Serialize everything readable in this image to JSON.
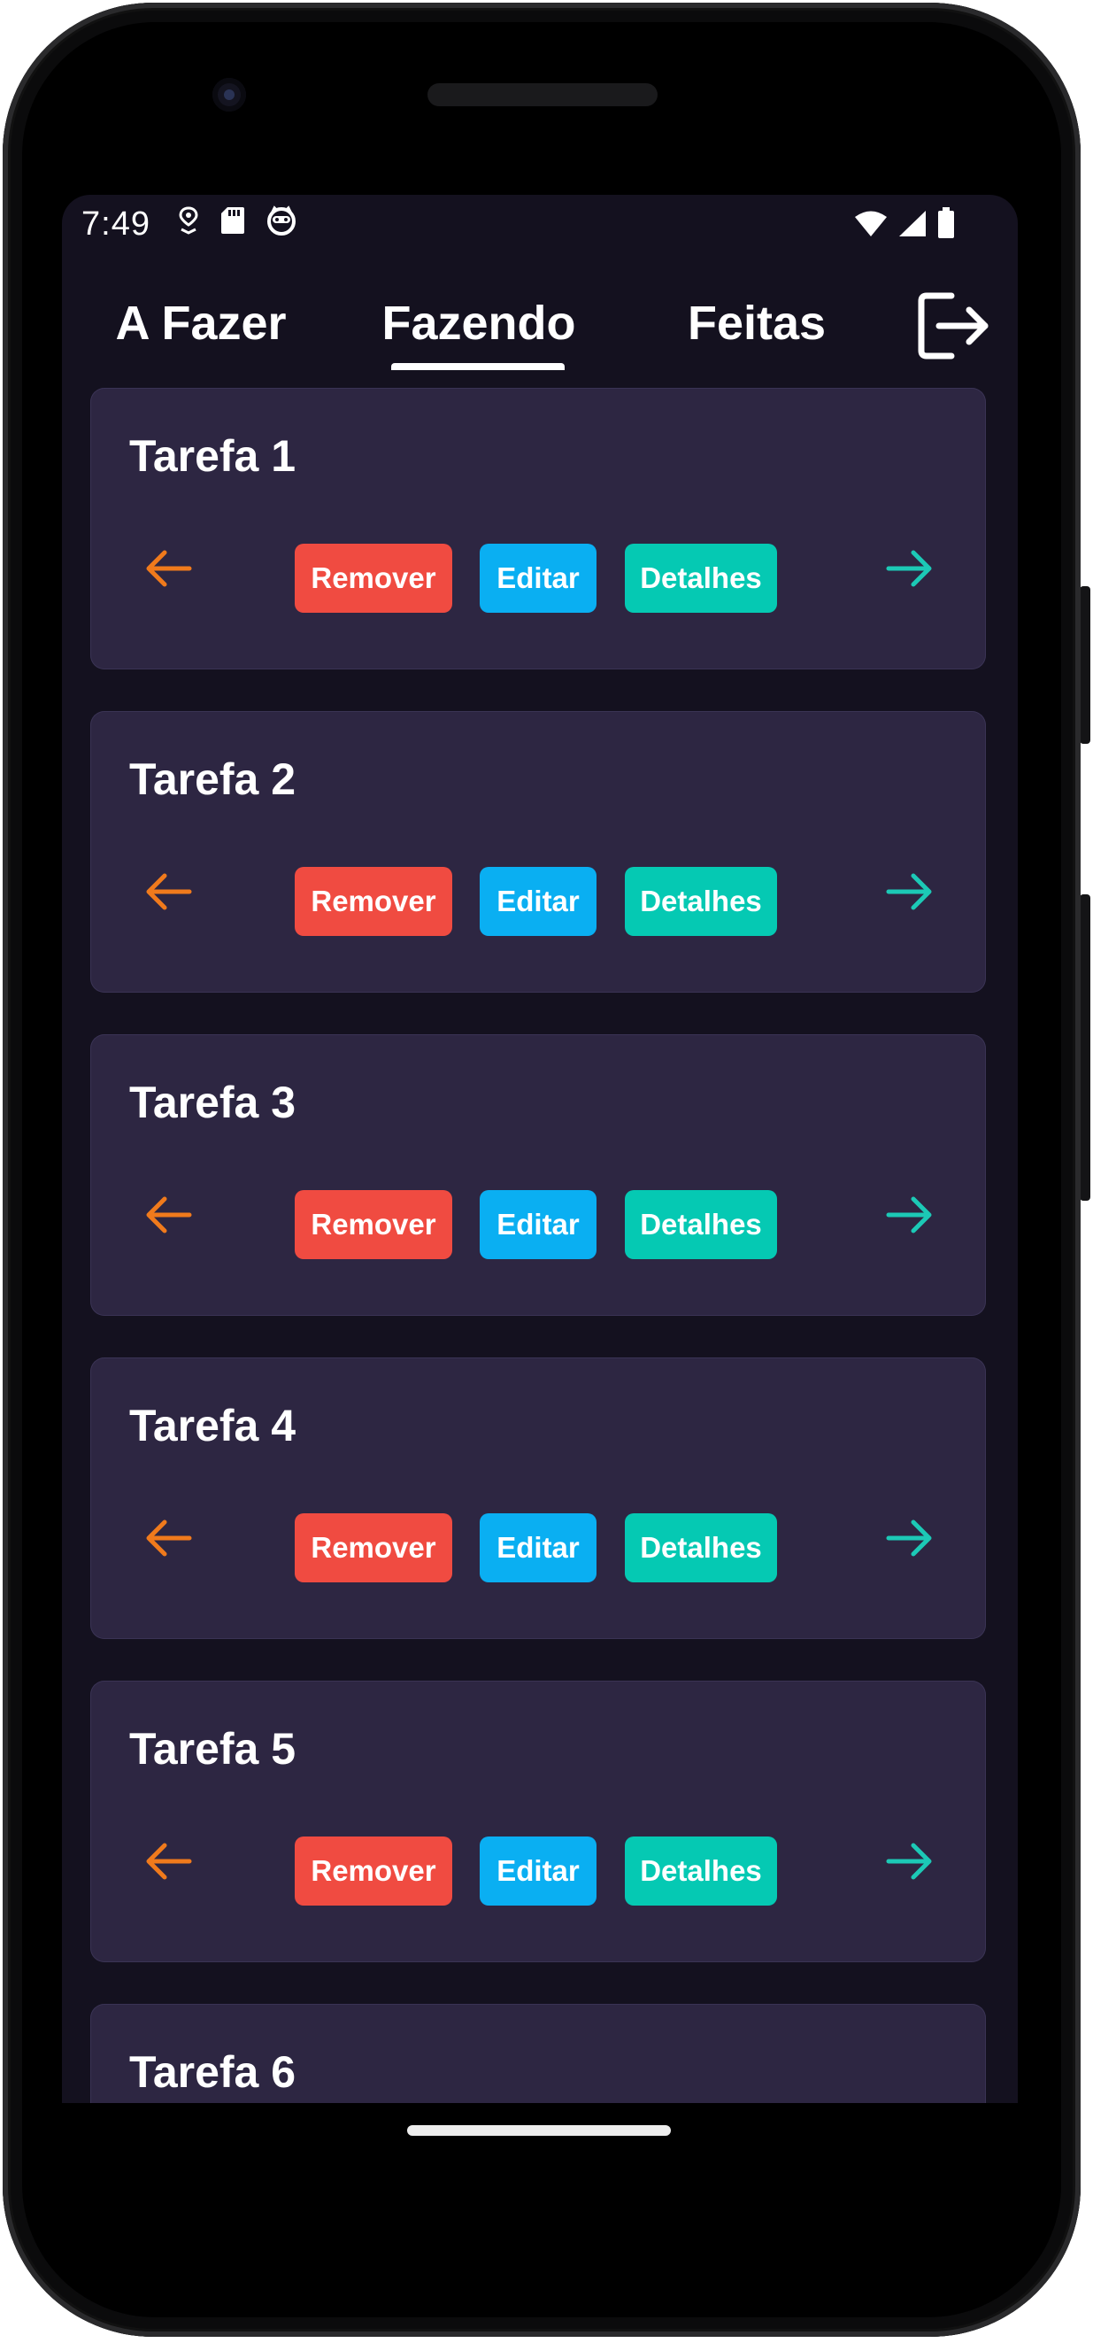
{
  "status_bar": {
    "time": "7:49",
    "left_icons": [
      "location-pin-icon",
      "sd-card-icon",
      "cat-face-icon"
    ],
    "right_icons": [
      "wifi-icon",
      "cell-signal-icon",
      "battery-icon"
    ]
  },
  "tabs": [
    {
      "label": "A Fazer",
      "active": false
    },
    {
      "label": "Fazendo",
      "active": true
    },
    {
      "label": "Feitas",
      "active": false
    }
  ],
  "header": {
    "logout_icon": "logout-icon"
  },
  "colors": {
    "background": "#14111f",
    "card": "#2d2642",
    "remove": "#f04b41",
    "edit": "#0aaff2",
    "details": "#05c9b3",
    "arrow_back": "#f07a1c",
    "arrow_forward": "#1cc9b6"
  },
  "actions": {
    "remove": "Remover",
    "edit": "Editar",
    "details": "Detalhes"
  },
  "tasks": [
    {
      "title": "Tarefa 1"
    },
    {
      "title": "Tarefa 2"
    },
    {
      "title": "Tarefa 3"
    },
    {
      "title": "Tarefa 4"
    },
    {
      "title": "Tarefa 5"
    },
    {
      "title": "Tarefa 6"
    }
  ]
}
